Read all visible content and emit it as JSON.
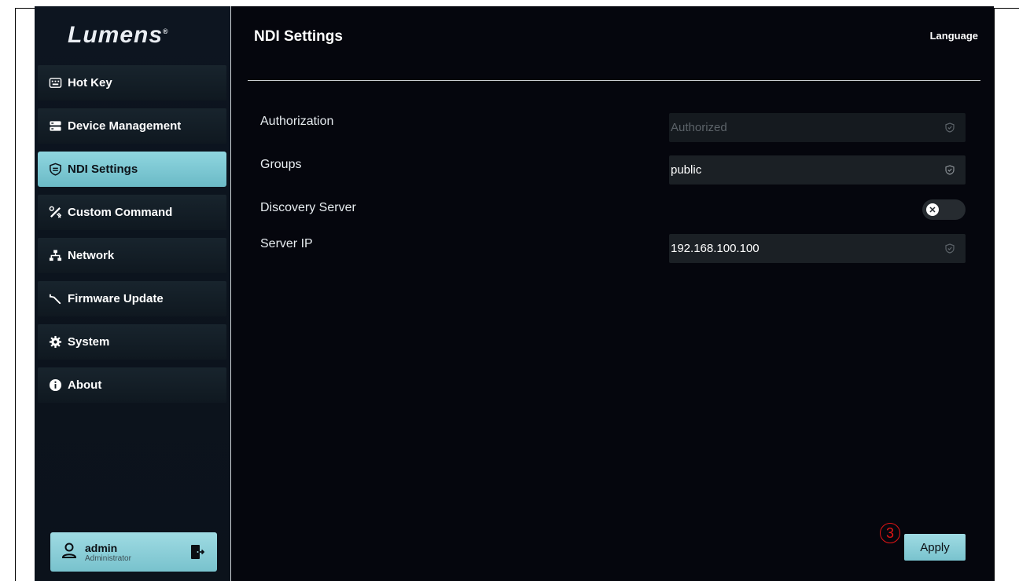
{
  "brand": {
    "logo": "Lumens",
    "trademark": "®"
  },
  "sidebar": {
    "items": [
      {
        "label": "Hot Key",
        "icon": "keyboard-icon"
      },
      {
        "label": "Device Management",
        "icon": "server-icon"
      },
      {
        "label": "NDI Settings",
        "icon": "shield-icon",
        "active": true
      },
      {
        "label": "Custom Command",
        "icon": "tools-icon"
      },
      {
        "label": "Network",
        "icon": "network-icon"
      },
      {
        "label": "Firmware Update",
        "icon": "wrench-icon"
      },
      {
        "label": "System",
        "icon": "gear-icon"
      },
      {
        "label": "About",
        "icon": "info-icon"
      }
    ]
  },
  "user": {
    "name": "admin",
    "role": "Administrator"
  },
  "header": {
    "title": "NDI Settings",
    "language": "Language"
  },
  "form": {
    "authorization": {
      "label": "Authorization",
      "value": "Authorized"
    },
    "groups": {
      "label": "Groups",
      "value": "public"
    },
    "discovery": {
      "label": "Discovery Server",
      "enabled": false,
      "knob_symbol": "✕"
    },
    "server_ip": {
      "label": "Server IP",
      "value": "192.168.100.100"
    }
  },
  "apply": {
    "label": "Apply"
  },
  "annotation": {
    "marker": "3"
  },
  "colors": {
    "accent": "#8fd6e0",
    "background": "#05060d",
    "annotation": "#e01515"
  }
}
